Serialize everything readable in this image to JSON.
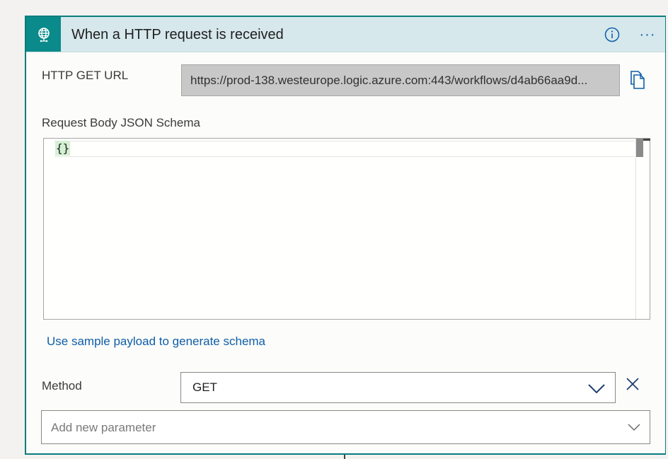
{
  "header": {
    "title": "When a HTTP request is received",
    "trigger_icon": "globe-request-icon",
    "info_icon": "info-icon",
    "more_label": "···",
    "accent_color": "#0a8a8a",
    "header_bg": "#d6e8ec"
  },
  "url": {
    "label": "HTTP GET URL",
    "value": "https://prod-138.westeurope.logic.azure.com:443/workflows/d4ab66aa9d...",
    "copy_icon": "copy-icon"
  },
  "schema": {
    "label": "Request Body JSON Schema",
    "content": "{}"
  },
  "sample_link": "Use sample payload to generate schema",
  "method": {
    "label": "Method",
    "value": "GET",
    "chevron_icon": "chevron-down-icon",
    "remove_icon": "close-icon"
  },
  "add_parameter": {
    "placeholder": "Add new parameter",
    "chevron_icon": "chevron-down-icon"
  },
  "colors": {
    "link": "#0f5ea8",
    "border": "#0a7d7d"
  }
}
